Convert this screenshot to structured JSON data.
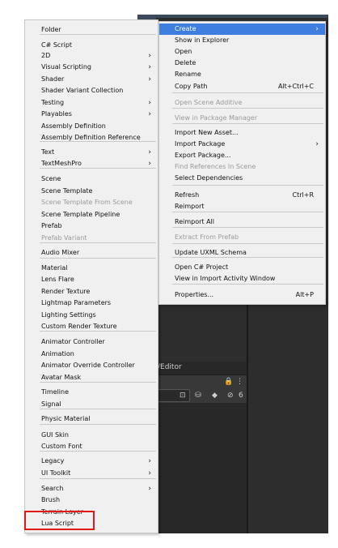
{
  "editor": {
    "path_label": "/Editor",
    "toolbar_badge": "6"
  },
  "left_menu": {
    "items": [
      {
        "label": "Folder"
      },
      {
        "label": "C# Script"
      },
      {
        "label": "2D",
        "submenu": true
      },
      {
        "label": "Visual Scripting",
        "submenu": true
      },
      {
        "label": "Shader",
        "submenu": true
      },
      {
        "label": "Shader Variant Collection"
      },
      {
        "label": "Testing",
        "submenu": true
      },
      {
        "label": "Playables",
        "submenu": true
      },
      {
        "label": "Assembly Definition"
      },
      {
        "label": "Assembly Definition Reference"
      },
      {
        "label": "Text",
        "submenu": true
      },
      {
        "label": "TextMeshPro",
        "submenu": true
      },
      {
        "label": "Scene"
      },
      {
        "label": "Scene Template"
      },
      {
        "label": "Scene Template From Scene",
        "disabled": true
      },
      {
        "label": "Scene Template Pipeline"
      },
      {
        "label": "Prefab"
      },
      {
        "label": "Prefab Variant",
        "disabled": true
      },
      {
        "label": "Audio Mixer"
      },
      {
        "label": "Material"
      },
      {
        "label": "Lens Flare"
      },
      {
        "label": "Render Texture"
      },
      {
        "label": "Lightmap Parameters"
      },
      {
        "label": "Lighting Settings"
      },
      {
        "label": "Custom Render Texture"
      },
      {
        "label": "Animator Controller"
      },
      {
        "label": "Animation"
      },
      {
        "label": "Animator Override Controller"
      },
      {
        "label": "Avatar Mask"
      },
      {
        "label": "Timeline"
      },
      {
        "label": "Signal"
      },
      {
        "label": "Physic Material"
      },
      {
        "label": "GUI Skin"
      },
      {
        "label": "Custom Font"
      },
      {
        "label": "Legacy",
        "submenu": true
      },
      {
        "label": "UI Toolkit",
        "submenu": true
      },
      {
        "label": "Search",
        "submenu": true
      },
      {
        "label": "Brush"
      },
      {
        "label": "Terrain Layer"
      },
      {
        "label": "Lua Script"
      }
    ]
  },
  "right_menu": {
    "items": [
      {
        "label": "Create",
        "submenu": true,
        "highlight": true
      },
      {
        "label": "Show in Explorer"
      },
      {
        "label": "Open"
      },
      {
        "label": "Delete"
      },
      {
        "label": "Rename"
      },
      {
        "label": "Copy Path",
        "shortcut": "Alt+Ctrl+C"
      },
      {
        "label": "Open Scene Additive",
        "disabled": true
      },
      {
        "label": "View in Package Manager",
        "disabled": true
      },
      {
        "label": "Import New Asset..."
      },
      {
        "label": "Import Package",
        "submenu": true
      },
      {
        "label": "Export Package..."
      },
      {
        "label": "Find References In Scene",
        "disabled": true
      },
      {
        "label": "Select Dependencies"
      },
      {
        "label": "Refresh",
        "shortcut": "Ctrl+R"
      },
      {
        "label": "Reimport"
      },
      {
        "label": "Reimport All"
      },
      {
        "label": "Extract From Prefab",
        "disabled": true
      },
      {
        "label": "Update UXML Schema"
      },
      {
        "label": "Open C# Project"
      },
      {
        "label": "View in Import Activity Window"
      },
      {
        "label": "Properties...",
        "shortcut": "Alt+P"
      }
    ]
  },
  "colors": {
    "highlight": "#3d7ede",
    "annotation_box": "#e01818"
  }
}
